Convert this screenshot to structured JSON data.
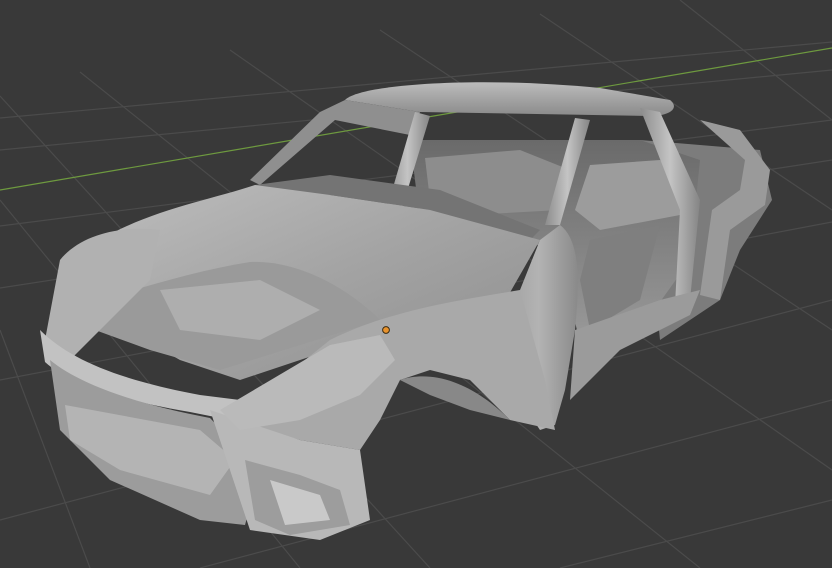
{
  "viewport": {
    "background_color": "#393939",
    "grid_color": "#4b4b4b",
    "x_axis_color": "#6e9a3f",
    "mesh_base_color": "#a7a7a7",
    "origin_color": "#e8922c"
  },
  "scene": {
    "object": "car-body-shell",
    "shading": "solid",
    "origin_visible": true
  }
}
